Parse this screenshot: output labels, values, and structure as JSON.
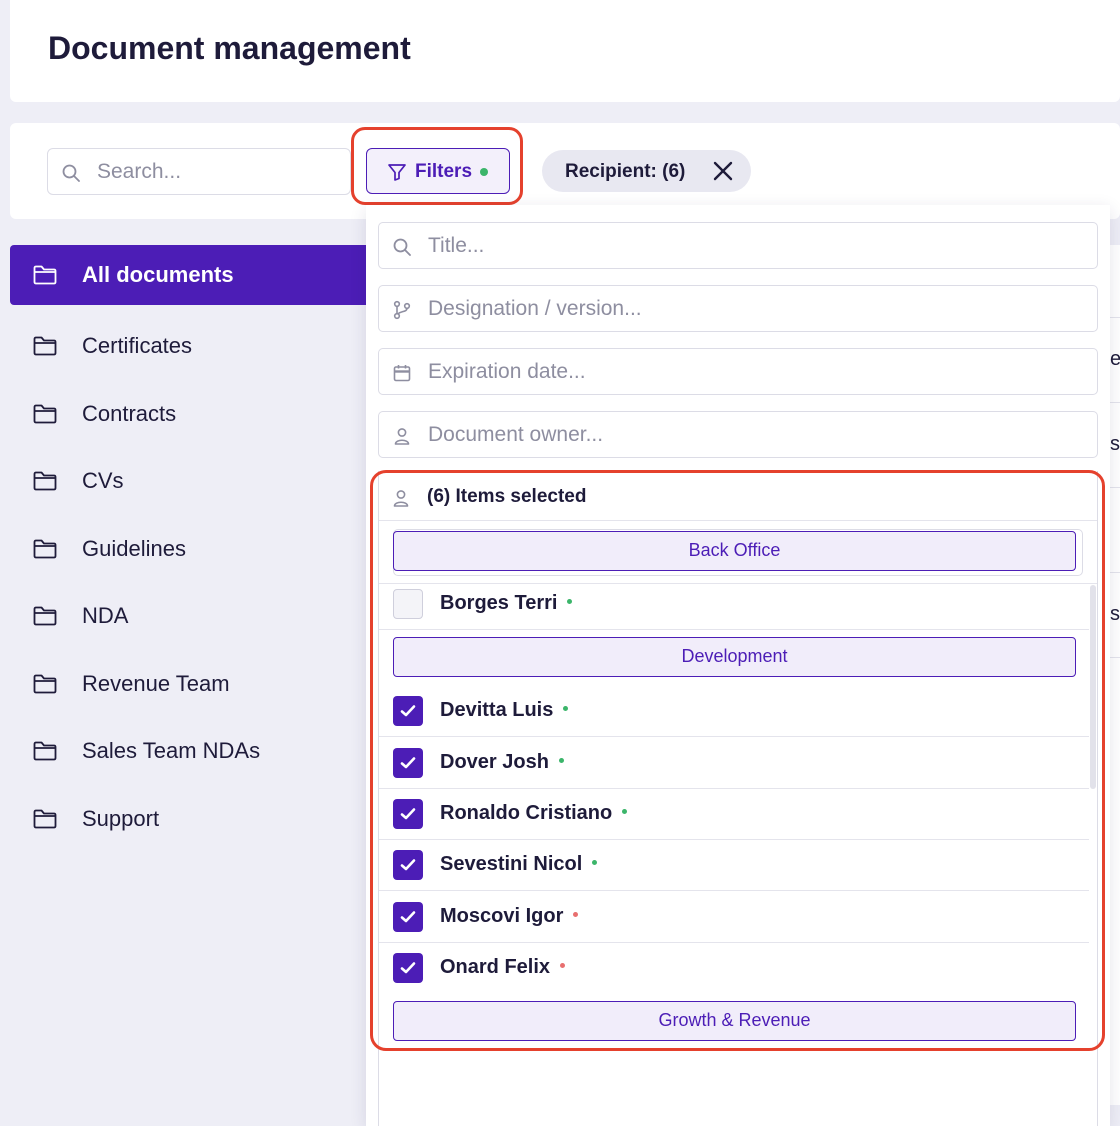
{
  "header": {
    "title": "Document management"
  },
  "toolbar": {
    "search_placeholder": "Search...",
    "filters_label": "Filters",
    "recipient_chip": "Recipient: (6)"
  },
  "sidebar": {
    "items": [
      {
        "label": "All documents",
        "active": true
      },
      {
        "label": "Certificates"
      },
      {
        "label": "Contracts"
      },
      {
        "label": "CVs"
      },
      {
        "label": "Guidelines"
      },
      {
        "label": "NDA"
      },
      {
        "label": "Revenue Team"
      },
      {
        "label": "Sales Team NDAs"
      },
      {
        "label": "Support"
      }
    ]
  },
  "table_edge": {
    "chars": [
      "e",
      "s",
      "s"
    ]
  },
  "filter_panel": {
    "title_placeholder": "Title...",
    "designation_placeholder": "Designation / version...",
    "expiration_placeholder": "Expiration date...",
    "owner_placeholder": "Document owner...",
    "recipient_summary": "(6) Items selected",
    "recipient_search_value": "",
    "groups": [
      {
        "label": "Back Office",
        "people": [
          {
            "name": "Borges Terri",
            "checked": false,
            "status": "online"
          }
        ]
      },
      {
        "label": "Development",
        "people": [
          {
            "name": "Devitta Luis",
            "checked": true,
            "status": "online"
          },
          {
            "name": "Dover Josh",
            "checked": true,
            "status": "online"
          },
          {
            "name": "Ronaldo Cristiano",
            "checked": true,
            "status": "online"
          },
          {
            "name": "Sevestini Nicol",
            "checked": true,
            "status": "online"
          },
          {
            "name": "Moscovi Igor",
            "checked": true,
            "status": "offline"
          },
          {
            "name": "Onard Felix",
            "checked": true,
            "status": "offline"
          }
        ]
      },
      {
        "label": "Growth & Revenue",
        "people": []
      }
    ]
  },
  "colors": {
    "accent": "#4c1db6",
    "highlight": "#e5412d",
    "online": "#3bb56a",
    "offline": "#e86f6f"
  }
}
